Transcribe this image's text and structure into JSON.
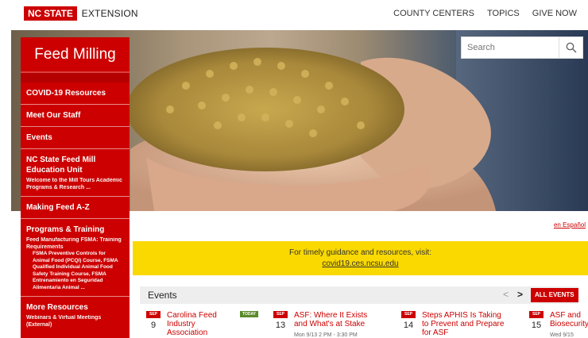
{
  "brand": {
    "box": "NC STATE",
    "suffix": "EXTENSION"
  },
  "topnav": [
    "COUNTY CENTERS",
    "TOPICS",
    "GIVE NOW"
  ],
  "search": {
    "placeholder": "Search"
  },
  "sidebar": {
    "title": "Feed Milling",
    "items": [
      {
        "label": "COVID-19 Resources"
      },
      {
        "label": "Meet Our Staff"
      },
      {
        "label": "Events"
      },
      {
        "label": "NC State Feed Mill Education Unit",
        "sub": "Welcome to the Mill Tours Academic Programs & Research ..."
      },
      {
        "label": "Making Feed A-Z"
      },
      {
        "label": "Programs & Training",
        "sub": "Feed Manufacturing FSMA: Training Requirements",
        "subs": [
          "FSMA Preventive Controls for Animal Food (PCQI) Course, FSMA",
          "Qualified Individual Animal Food Safety Training Course, FSMA",
          "Entrenamiento en Seguridad Alimentaria Animal ..."
        ]
      },
      {
        "label": "More Resources",
        "sub": "Webinars & Virtual Meetings (External)"
      }
    ]
  },
  "espanol": "en Español",
  "covid": {
    "text": "For timely guidance and resources, visit:",
    "link": "covid19.ces.ncsu.edu"
  },
  "events": {
    "title": "Events",
    "prev": "<",
    "next": ">",
    "all_label": "ALL EVENTS",
    "items": [
      {
        "month": "SEP",
        "day": "9",
        "title": "Carolina Feed Industry Association",
        "meta": "",
        "badge": "TODAY"
      },
      {
        "month": "SEP",
        "day": "13",
        "title": "ASF: Where It Exists and What's at Stake",
        "meta": "Mon 9/13 2 PM - 3:30 PM",
        "badge": ""
      },
      {
        "month": "SEP",
        "day": "14",
        "title": "Steps APHIS Is Taking to Prevent and Prepare for ASF",
        "meta": "",
        "badge": ""
      },
      {
        "month": "SEP",
        "day": "15",
        "title": "ASF and Biosecurity",
        "meta": "Wed 9/15",
        "badge": ""
      }
    ]
  },
  "colors": {
    "accent": "#cc0000",
    "banner": "#fad900",
    "today": "#5a8a2a"
  },
  "icons": {
    "search": "search-icon",
    "prev": "chevron-left-icon",
    "next": "chevron-right-icon"
  }
}
